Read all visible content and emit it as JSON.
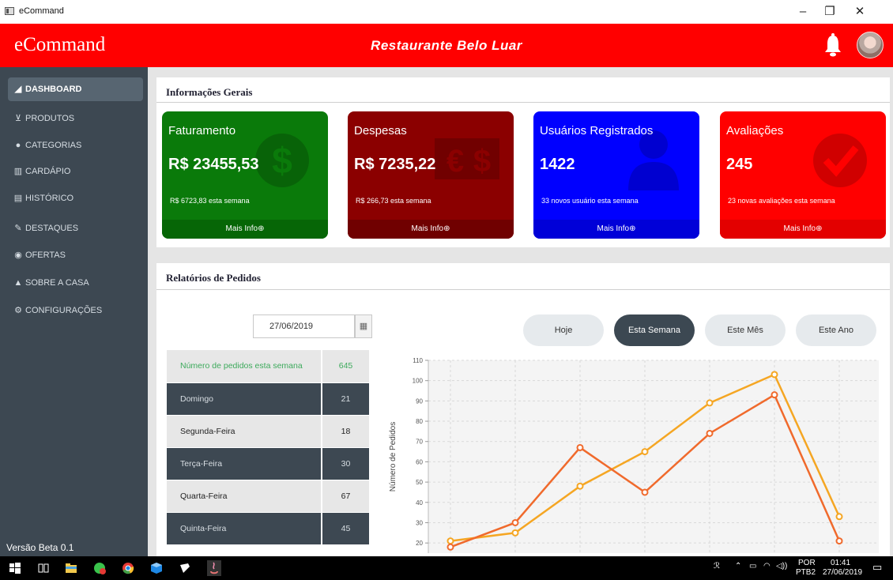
{
  "window": {
    "title": "eCommand",
    "minimize": "–",
    "maximize": "❐",
    "close": "✕"
  },
  "header": {
    "brand": "eCommand",
    "restaurant": "Restaurante Belo Luar"
  },
  "sidebar": {
    "items": [
      {
        "label": "DASHBOARD",
        "icon": "dashboard-icon",
        "glyph": "◢"
      },
      {
        "label": "PRODUTOS",
        "icon": "cart-icon",
        "glyph": "🛒"
      },
      {
        "label": "CATEGORIAS",
        "icon": "tag-icon",
        "glyph": "●"
      },
      {
        "label": "CARDÁPIO",
        "icon": "menu-book-icon",
        "glyph": "▥"
      },
      {
        "label": "HISTÓRICO",
        "icon": "history-icon",
        "glyph": "▤"
      },
      {
        "label": "DESTAQUES",
        "icon": "star-pen-icon",
        "glyph": "✎"
      },
      {
        "label": "OFERTAS",
        "icon": "offer-icon",
        "glyph": "◉"
      },
      {
        "label": "SOBRE A CASA",
        "icon": "house-icon",
        "glyph": "▲"
      },
      {
        "label": "CONFIGURAÇÕES",
        "icon": "settings-icon",
        "glyph": "⚙"
      }
    ],
    "version": "Versão Beta 0.1"
  },
  "general": {
    "title": "Informações Gerais",
    "cards": [
      {
        "title": "Faturamento",
        "value": "R$ 23455,53",
        "sub": "R$ 6723,83 esta semana",
        "more": "Mais Info⊕",
        "color": "#0a7a0a",
        "foot": "#066606",
        "icon": "dollar-icon"
      },
      {
        "title": "Despesas",
        "value": "R$ 7235,22",
        "sub": "R$ 266,73 esta semana",
        "more": "Mais Info⊕",
        "color": "#8b0000",
        "foot": "#700000",
        "icon": "money-icon"
      },
      {
        "title": "Usuários Registrados",
        "value": "1422",
        "sub": "33 novos usuário esta semana",
        "more": "Mais Info⊕",
        "color": "#0000ff",
        "foot": "#0000d8",
        "icon": "user-icon"
      },
      {
        "title": "Avaliações",
        "value": "245",
        "sub": "23 novas avaliações esta semana",
        "more": "Mais Info⊕",
        "color": "#ff0000",
        "foot": "#e30000",
        "icon": "check-icon"
      }
    ]
  },
  "orders": {
    "title": "Relatórios de Pedidos",
    "date": "27/06/2019",
    "filters": [
      "Hoje",
      "Esta Semana",
      "Este Mês",
      "Este Ano"
    ],
    "active_filter": "Esta Semana",
    "rows": [
      {
        "label": "Número de pedidos esta semana",
        "value": "645"
      },
      {
        "label": "Domingo",
        "value": "21"
      },
      {
        "label": "Segunda-Feira",
        "value": "18"
      },
      {
        "label": "Terça-Feira",
        "value": "30"
      },
      {
        "label": "Quarta-Feira",
        "value": "67"
      },
      {
        "label": "Quinta-Feira",
        "value": "45"
      }
    ]
  },
  "chart_data": {
    "type": "line",
    "ylabel": "Número de Pedidos",
    "ylim": [
      15,
      110
    ],
    "yticks": [
      20,
      30,
      40,
      50,
      60,
      70,
      80,
      90,
      100,
      110
    ],
    "grid": true,
    "series": [
      {
        "color": "#f5a623",
        "values": [
          21,
          25,
          48,
          65,
          89,
          103,
          33
        ]
      },
      {
        "color": "#f06a2c",
        "values": [
          18,
          30,
          67,
          45,
          74,
          93,
          21
        ]
      }
    ]
  },
  "taskbar": {
    "lang": "POR",
    "layout": "PTB2",
    "time": "01:41",
    "date": "27/06/2019"
  }
}
